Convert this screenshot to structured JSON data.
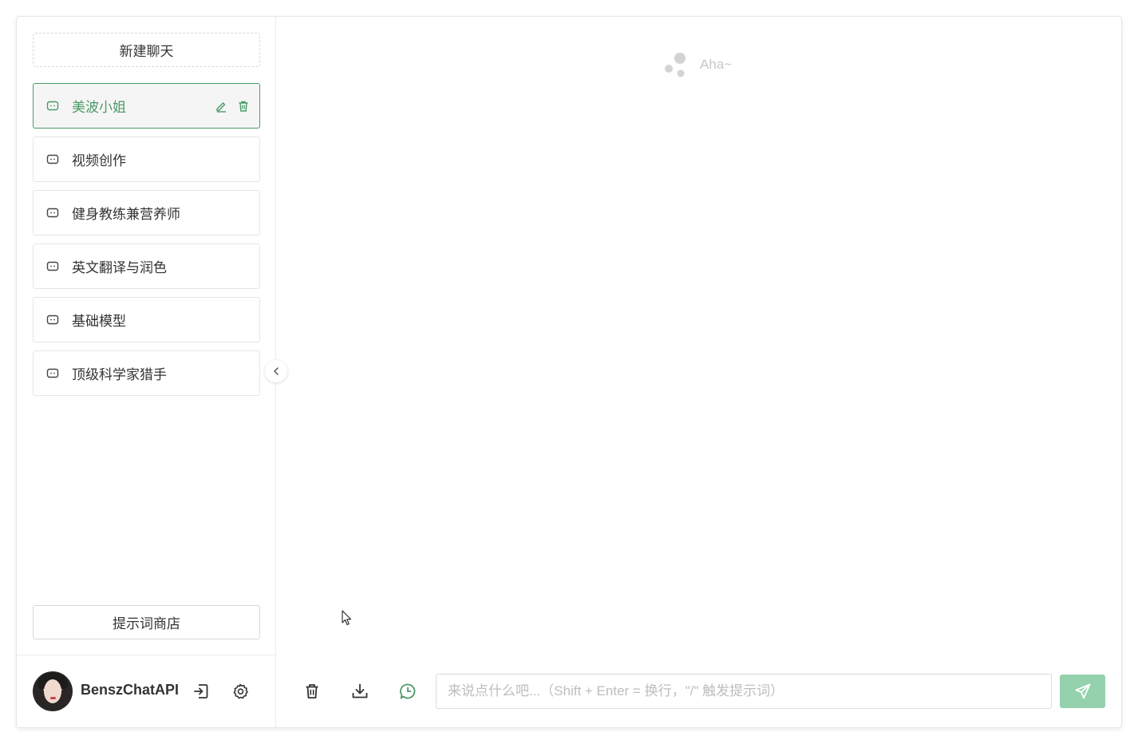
{
  "sidebar": {
    "new_chat_label": "新建聊天",
    "conversations": [
      {
        "label": "美波小姐",
        "active": true
      },
      {
        "label": "视频创作",
        "active": false
      },
      {
        "label": "健身教练兼营养师",
        "active": false
      },
      {
        "label": "英文翻译与润色",
        "active": false
      },
      {
        "label": "基础模型",
        "active": false
      },
      {
        "label": "顶级科学家猎手",
        "active": false
      }
    ],
    "prompt_store_label": "提示词商店",
    "user": {
      "name": "BenszChatAPI"
    },
    "icons": [
      "chat-bubble-icon",
      "edit-icon",
      "trash-icon",
      "logout-icon",
      "settings-icon",
      "chevron-left-icon"
    ]
  },
  "main": {
    "empty_text": "Aha~",
    "input_placeholder": "来说点什么吧...（Shift + Enter = 换行，\"/\" 触发提示词）",
    "toolbar_icons": [
      "trash-icon",
      "download-icon",
      "whatsapp-icon",
      "send-icon"
    ]
  },
  "colors": {
    "accent": "#4a9a67",
    "send_button": "#93d2ac",
    "muted_text": "#c8c8c8",
    "border": "#e6e6e6"
  }
}
